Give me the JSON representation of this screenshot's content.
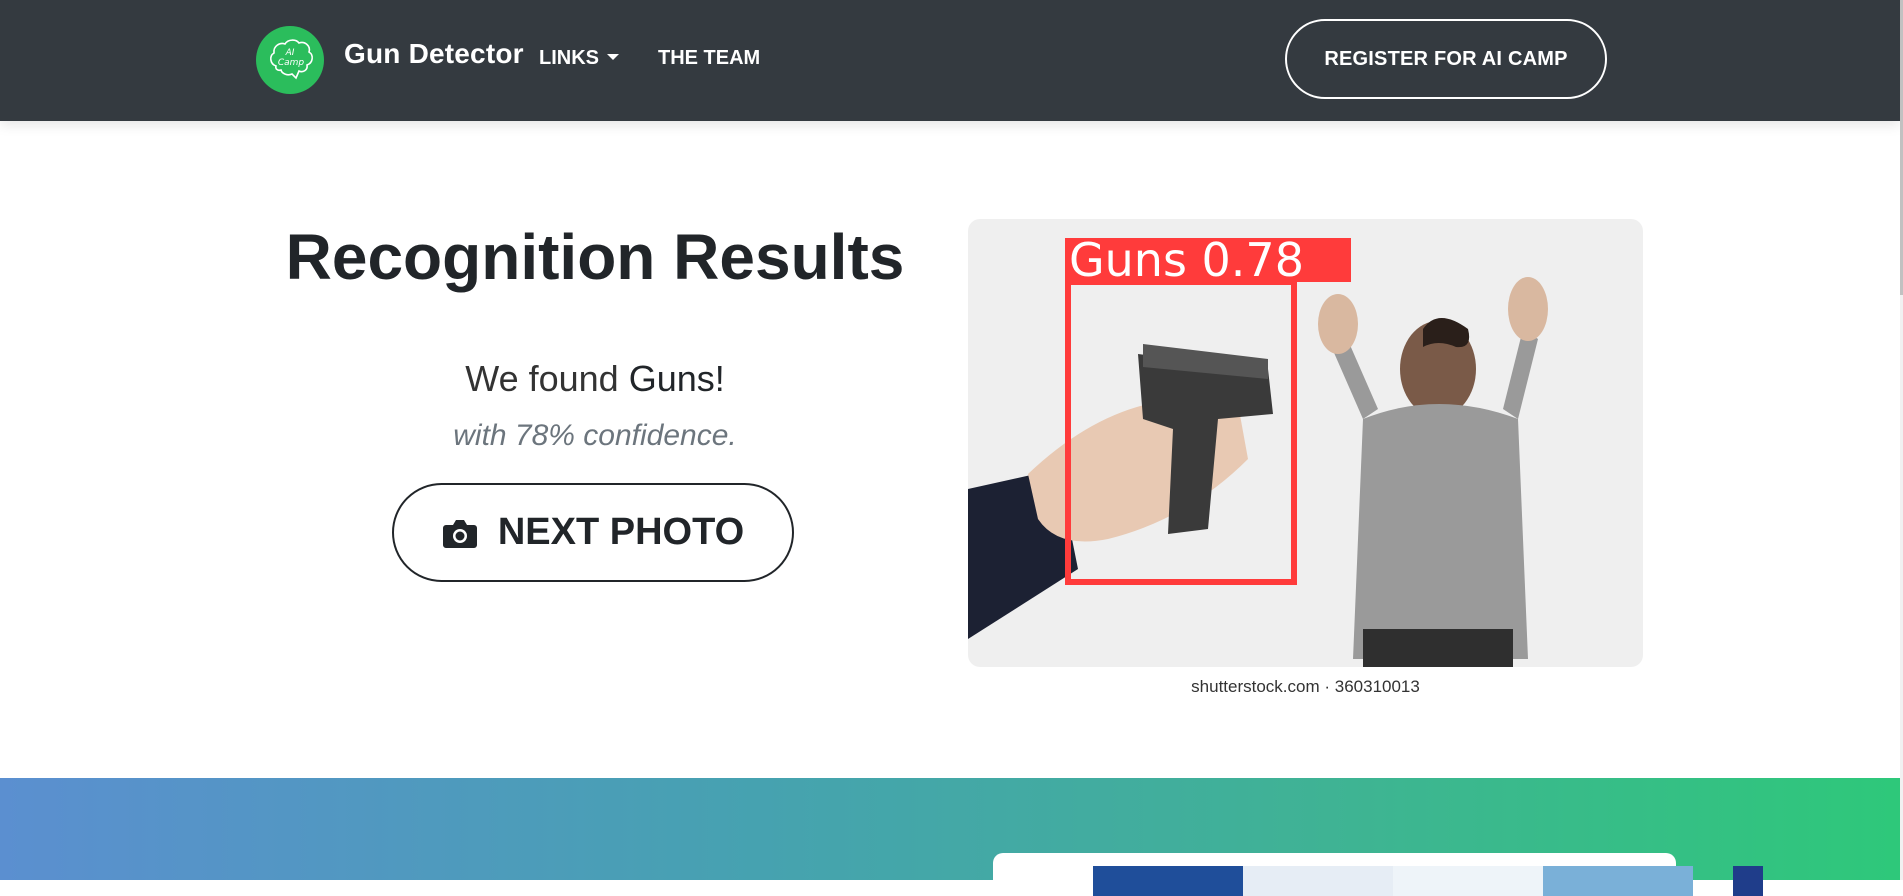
{
  "navbar": {
    "brand": "Gun Detector",
    "logo_text": "AI Camp",
    "links_label": "LINKS",
    "team_label": "THE TEAM",
    "register_label": "REGISTER FOR AI CAMP"
  },
  "main": {
    "title": "Recognition Results",
    "result_prefix": "We found ",
    "detected_object": "Guns",
    "result_suffix": "!",
    "confidence_text": "with 78% confidence.",
    "next_button_label": "NEXT PHOTO",
    "next_button_icon": "camera-icon"
  },
  "result_image": {
    "detection_label": "Guns 0.78",
    "detection_class": "Guns",
    "detection_score": 0.78,
    "watermark": "shutterstock.com · 360310013",
    "box_color": "#ff3b3b"
  },
  "colors": {
    "navbar_bg": "#343a40",
    "logo_green": "#2bbd5c",
    "gradient_start": "#5b8fd0",
    "gradient_end": "#2ec87a"
  }
}
